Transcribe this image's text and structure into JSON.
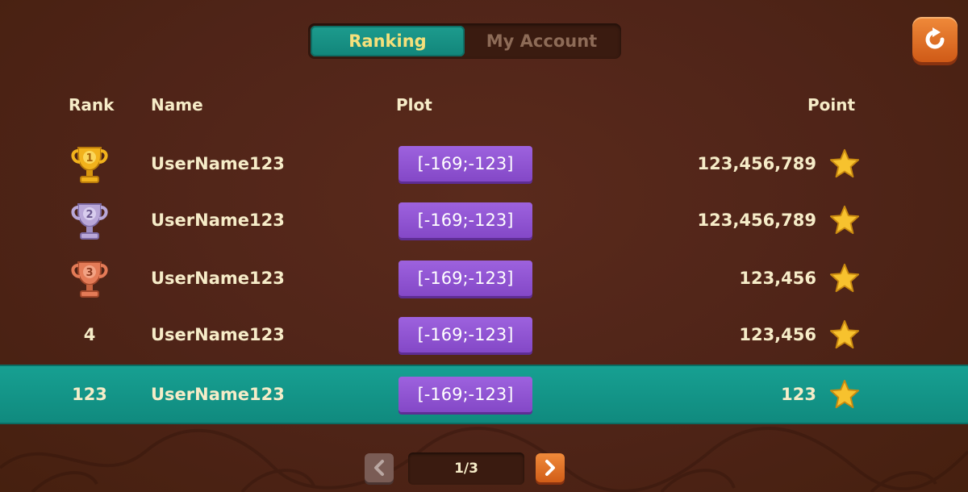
{
  "tabs": [
    {
      "label": "Ranking",
      "active": true
    },
    {
      "label": "My Account",
      "active": false
    }
  ],
  "refresh_icon": "refresh-icon",
  "columns": {
    "rank": "Rank",
    "name": "Name",
    "plot": "Plot",
    "point": "Point"
  },
  "rows": [
    {
      "rank": "1",
      "badge": "gold-trophy",
      "name": "UserName123",
      "plot": "[-169;-123]",
      "points": "123,456,789"
    },
    {
      "rank": "2",
      "badge": "silver-trophy",
      "name": "UserName123",
      "plot": "[-169;-123]",
      "points": "123,456,789"
    },
    {
      "rank": "3",
      "badge": "bronze-trophy",
      "name": "UserName123",
      "plot": "[-169;-123]",
      "points": "123,456"
    },
    {
      "rank": "4",
      "badge": "",
      "name": "UserName123",
      "plot": "[-169;-123]",
      "points": "123,456"
    }
  ],
  "current_user": {
    "rank": "123",
    "name": "UserName123",
    "plot": "[-169;-123]",
    "points": "123",
    "highlight": true
  },
  "pager": {
    "page": "1/3"
  },
  "colors": {
    "background": "#4f2418",
    "teal_accent": "#17a092",
    "tab_active_text": "#f5e07b",
    "plot_button": "#9d62de",
    "orange_button": "#f08a3a",
    "star": "#f7c22e"
  }
}
